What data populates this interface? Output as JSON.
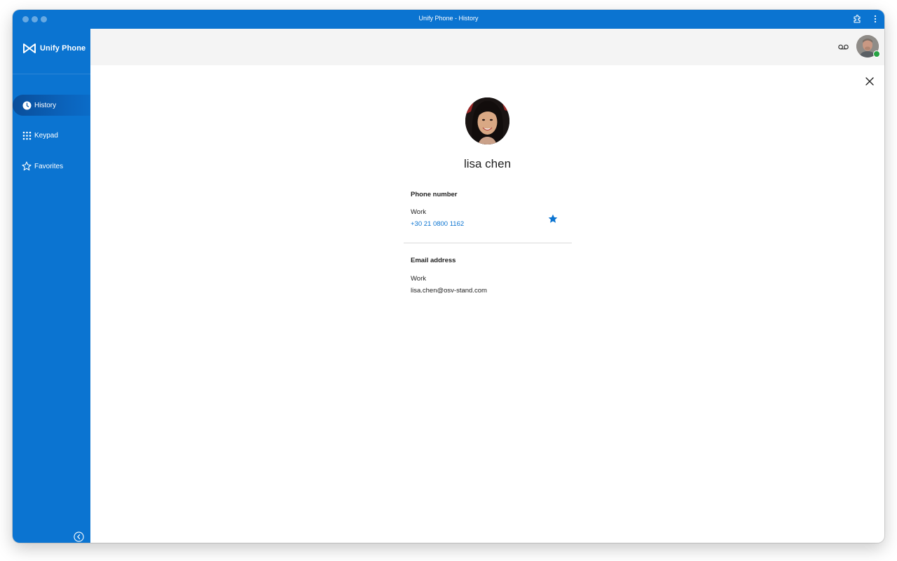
{
  "window": {
    "title": "Unify Phone - History"
  },
  "brand": {
    "name": "Unify Phone",
    "icon": "unify-logo-icon"
  },
  "sidebar": {
    "items": [
      {
        "label": "History",
        "icon": "clock-icon",
        "active": true
      },
      {
        "label": "Keypad",
        "icon": "keypad-icon",
        "active": false
      },
      {
        "label": "Favorites",
        "icon": "star-outline-icon",
        "active": false
      }
    ],
    "collapse_icon": "chevron-left-circle-icon"
  },
  "topbar": {
    "voicemail_icon": "voicemail-icon",
    "presence": "available"
  },
  "contact": {
    "name": "lisa chen",
    "phone_section_title": "Phone number",
    "phone_label": "Work",
    "phone_number": "+30 21 0800 1162",
    "email_section_title": "Email address",
    "email_label": "Work",
    "email": "lisa.chen@osv-stand.com",
    "is_favorite": true
  },
  "colors": {
    "brand_blue": "#0b74d1",
    "link_blue": "#0b74d1",
    "presence_green": "#27a243"
  }
}
